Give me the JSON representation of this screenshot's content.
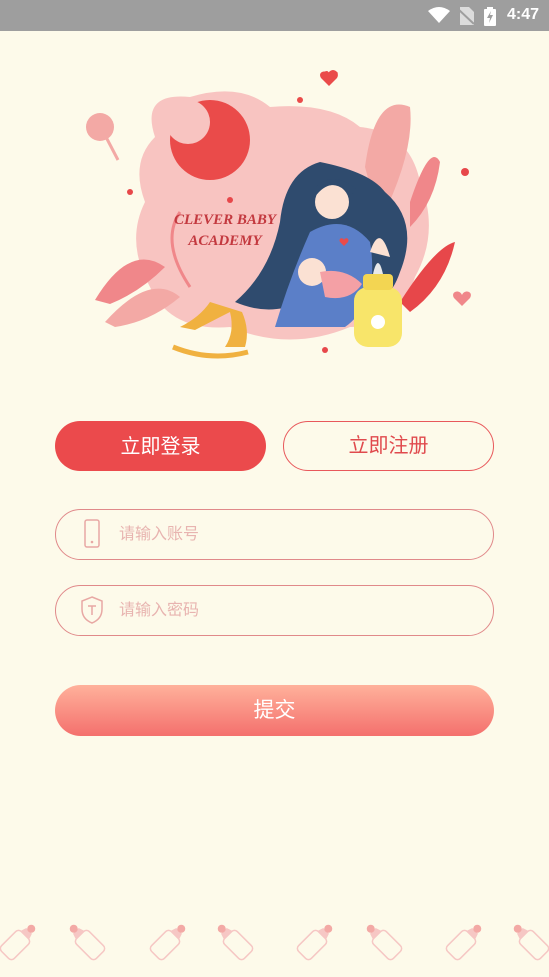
{
  "status_bar": {
    "time": "4:47",
    "wifi_icon": "wifi-icon",
    "sim_icon": "no-sim-icon",
    "battery_icon": "battery-charging-icon"
  },
  "hero": {
    "title_line1": "CLEVER BABY",
    "title_line2": "ACADEMY"
  },
  "tabs": {
    "login_label": "立即登录",
    "register_label": "立即注册"
  },
  "form": {
    "account_placeholder": "请输入账号",
    "password_placeholder": "请输入密码",
    "account_icon": "phone-icon",
    "password_icon": "shield-icon",
    "submit_label": "提交"
  },
  "colors": {
    "background": "#fdfaea",
    "accent": "#eb4a4c",
    "submit_gradient_top": "#ffb19b",
    "submit_gradient_bottom": "#f4706d"
  }
}
